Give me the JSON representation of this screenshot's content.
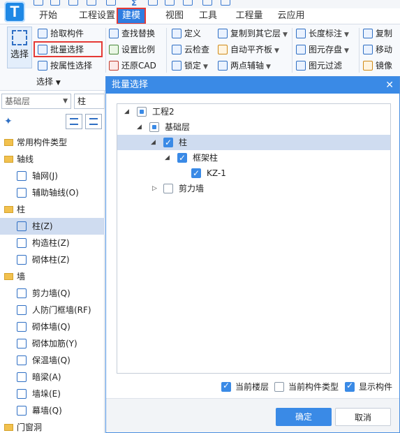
{
  "app": {
    "logo": "T"
  },
  "ribbon": {
    "tabs": [
      "开始",
      "工程设置",
      "建模",
      "视图",
      "工具",
      "工程量",
      "云应用"
    ],
    "active_tab": "建模",
    "select_group": {
      "big_button": "选择",
      "items": [
        "拾取构件",
        "批量选择",
        "按属性选择"
      ],
      "group_label": "选择"
    },
    "edit_col1": [
      "查找替换",
      "设置比例",
      "还原CAD"
    ],
    "edit_col2": [
      "定义",
      "云检查",
      "锁定"
    ],
    "edit_col3": [
      "复制到其它层",
      "自动平齐板",
      "两点辅轴"
    ],
    "edit_col4": [
      "长度标注",
      "图元存盘",
      "图元过滤"
    ],
    "edit_col5": [
      "复制",
      "移动",
      "镜像"
    ]
  },
  "left_panel": {
    "floor_select": "基础层",
    "type_select": "柱",
    "tree": [
      {
        "kind": "cat",
        "label": "常用构件类型"
      },
      {
        "kind": "cat",
        "label": "轴线"
      },
      {
        "kind": "child",
        "label": "轴网(J)"
      },
      {
        "kind": "child",
        "label": "辅助轴线(O)"
      },
      {
        "kind": "cat",
        "label": "柱"
      },
      {
        "kind": "child",
        "label": "柱(Z)",
        "selected": true
      },
      {
        "kind": "child",
        "label": "构造柱(Z)"
      },
      {
        "kind": "child",
        "label": "砌体柱(Z)"
      },
      {
        "kind": "cat",
        "label": "墙"
      },
      {
        "kind": "child",
        "label": "剪力墙(Q)"
      },
      {
        "kind": "child",
        "label": "人防门框墙(RF)"
      },
      {
        "kind": "child",
        "label": "砌体墙(Q)"
      },
      {
        "kind": "child",
        "label": "砌体加筋(Y)"
      },
      {
        "kind": "child",
        "label": "保温墙(Q)"
      },
      {
        "kind": "child",
        "label": "暗梁(A)"
      },
      {
        "kind": "child",
        "label": "墙垛(E)"
      },
      {
        "kind": "child",
        "label": "幕墙(Q)"
      },
      {
        "kind": "cat",
        "label": "门窗洞"
      }
    ]
  },
  "dialog": {
    "title": "批量选择",
    "tree": {
      "project": "工程2",
      "floor": "基础层",
      "category": "柱",
      "type": "框架柱",
      "member": "KZ-1",
      "other_category": "剪力墙"
    },
    "options": [
      {
        "label": "当前楼层",
        "checked": true
      },
      {
        "label": "当前构件类型",
        "checked": false
      },
      {
        "label": "显示构件",
        "checked": true
      }
    ],
    "ok": "确定",
    "cancel": "取消"
  }
}
